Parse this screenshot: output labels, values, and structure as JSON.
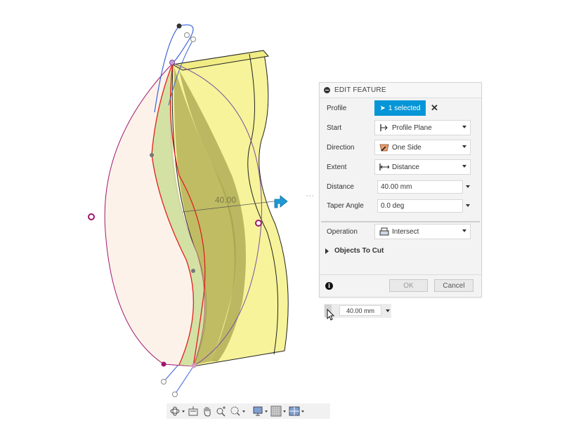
{
  "panel": {
    "title": "EDIT FEATURE",
    "rows": {
      "profile": {
        "label": "Profile",
        "value": "1 selected"
      },
      "start": {
        "label": "Start",
        "value": "Profile Plane"
      },
      "direction": {
        "label": "Direction",
        "value": "One Side"
      },
      "extent": {
        "label": "Extent",
        "value": "Distance"
      },
      "distance": {
        "label": "Distance",
        "value": "40.00 mm"
      },
      "taper": {
        "label": "Taper Angle",
        "value": "0.0 deg"
      },
      "operation": {
        "label": "Operation",
        "value": "Intersect"
      }
    },
    "objects_to_cut": "Objects To Cut",
    "ok_label": "OK",
    "cancel_label": "Cancel"
  },
  "mini_input": {
    "value": "40.00 mm"
  },
  "viewport": {
    "dimension_label": "40.00"
  },
  "colors": {
    "accent": "#0696d7",
    "body_yellow": "#f6f39a",
    "profile_fill": "#fdf2ea",
    "edge_red": "#e02020",
    "sketch_blue": "#3b63d8",
    "handle_magenta": "#a0166e"
  },
  "nav_toolbar": {
    "tools": [
      "orbit-icon",
      "look-at-icon",
      "pan-icon",
      "zoom-icon",
      "fit-icon",
      "display-settings-icon",
      "grid-icon",
      "viewports-icon"
    ]
  }
}
